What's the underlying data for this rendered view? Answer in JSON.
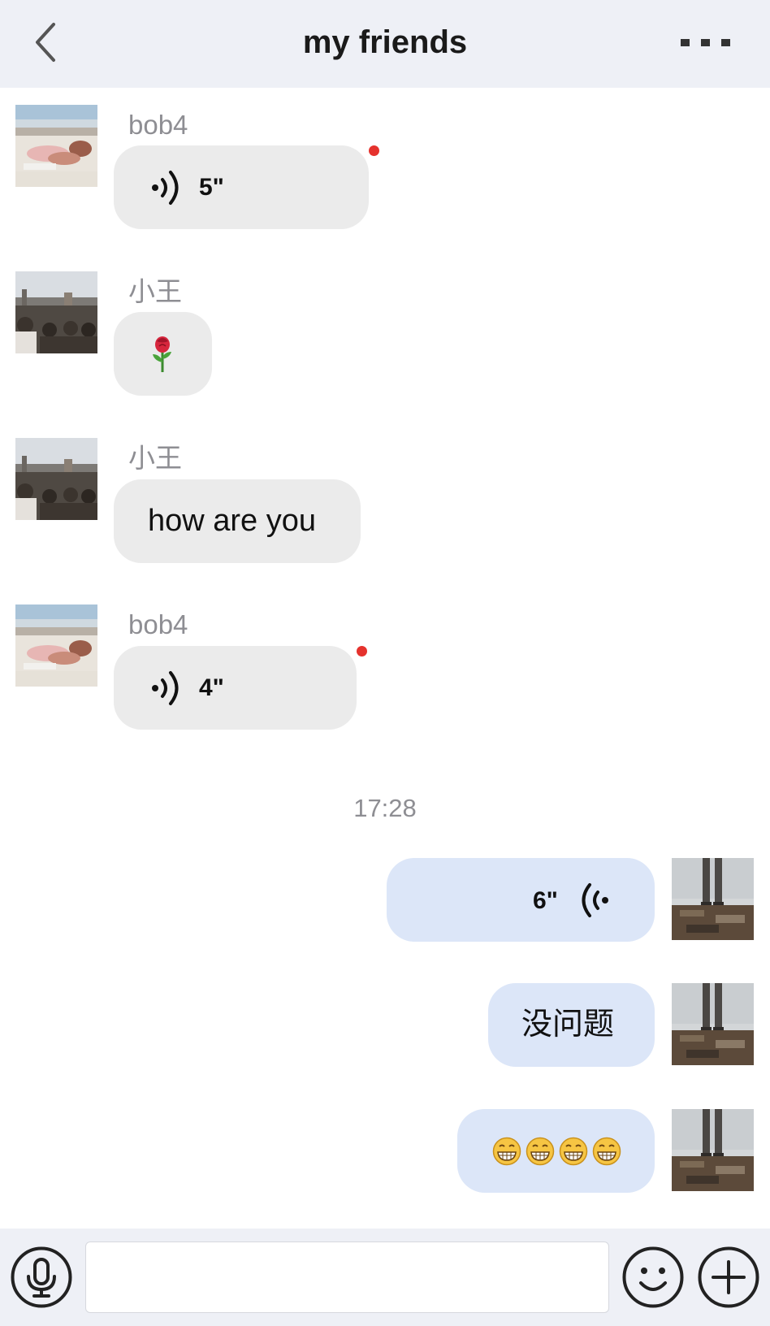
{
  "header": {
    "title": "my friends",
    "back_icon": "chevron-left-icon",
    "more_icon": "more-dots-icon"
  },
  "messages": [
    {
      "type": "voice",
      "direction": "incoming",
      "sender": "bob4",
      "duration": "5\"",
      "unread": true
    },
    {
      "type": "emoji",
      "direction": "incoming",
      "sender": "小王",
      "content": "rose-emoji"
    },
    {
      "type": "text",
      "direction": "incoming",
      "sender": "小王",
      "text": "how are you"
    },
    {
      "type": "voice",
      "direction": "incoming",
      "sender": "bob4",
      "duration": "4\"",
      "unread": true
    },
    {
      "type": "timestamp",
      "text": "17:28"
    },
    {
      "type": "voice",
      "direction": "outgoing",
      "duration": "6\""
    },
    {
      "type": "text",
      "direction": "outgoing",
      "text": "没问题"
    },
    {
      "type": "emoji",
      "direction": "outgoing",
      "content": "grinning-face-emoji",
      "count": 4
    }
  ],
  "input_bar": {
    "voice_icon": "microphone-icon",
    "input_value": "",
    "emoji_icon": "smiley-face-icon",
    "add_icon": "plus-icon"
  },
  "colors": {
    "header_bg": "#eef0f6",
    "incoming_bubble": "#ebebeb",
    "outgoing_bubble": "#dce6f8",
    "unread_dot": "#e5322d",
    "name_text": "#8e8e93"
  }
}
